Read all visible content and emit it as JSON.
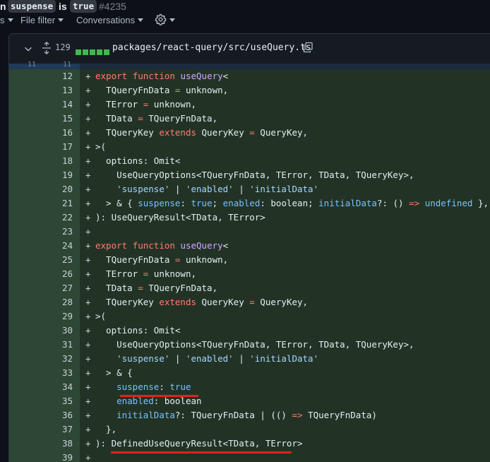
{
  "title": {
    "prefix": "n",
    "code1": "suspense",
    "word": "is",
    "code2": "true",
    "number": "#4235"
  },
  "toolbar": {
    "partial": "s",
    "file_filter": "File filter",
    "conversations": "Conversations",
    "settings_icon": "gear-icon"
  },
  "file": {
    "change_count": "129",
    "path": "packages/react-query/src/useQuery.ts",
    "copy_icon": "copy-icon"
  },
  "hunk": {
    "left": "11",
    "right": "11"
  },
  "lines": [
    {
      "n": "12",
      "tokens": [
        {
          "t": "export",
          "c": "kw"
        },
        {
          "t": " "
        },
        {
          "t": "function",
          "c": "kw"
        },
        {
          "t": " "
        },
        {
          "t": "useQuery",
          "c": "fn"
        },
        {
          "t": "<"
        }
      ]
    },
    {
      "n": "13",
      "tokens": [
        {
          "t": "  TQueryFnData "
        },
        {
          "t": "=",
          "c": "kw"
        },
        {
          "t": " unknown,"
        }
      ]
    },
    {
      "n": "14",
      "tokens": [
        {
          "t": "  TError "
        },
        {
          "t": "=",
          "c": "kw"
        },
        {
          "t": " unknown,"
        }
      ]
    },
    {
      "n": "15",
      "tokens": [
        {
          "t": "  TData "
        },
        {
          "t": "=",
          "c": "kw"
        },
        {
          "t": " TQueryFnData,"
        }
      ]
    },
    {
      "n": "16",
      "tokens": [
        {
          "t": "  TQueryKey "
        },
        {
          "t": "extends",
          "c": "kw"
        },
        {
          "t": " QueryKey "
        },
        {
          "t": "=",
          "c": "kw"
        },
        {
          "t": " QueryKey,"
        }
      ]
    },
    {
      "n": "17",
      "tokens": [
        {
          "t": ">("
        }
      ]
    },
    {
      "n": "18",
      "tokens": [
        {
          "t": "  options: Omit<"
        }
      ]
    },
    {
      "n": "19",
      "tokens": [
        {
          "t": "    UseQueryOptions<TQueryFnData, TError, TData, TQueryKey>,"
        }
      ]
    },
    {
      "n": "20",
      "tokens": [
        {
          "t": "    "
        },
        {
          "t": "'suspense'",
          "c": "str"
        },
        {
          "t": " | "
        },
        {
          "t": "'enabled'",
          "c": "str"
        },
        {
          "t": " | "
        },
        {
          "t": "'initialData'",
          "c": "str"
        }
      ]
    },
    {
      "n": "21",
      "tokens": [
        {
          "t": "  > & { "
        },
        {
          "t": "suspense",
          "c": "con"
        },
        {
          "t": ": "
        },
        {
          "t": "true",
          "c": "con"
        },
        {
          "t": "; "
        },
        {
          "t": "enabled",
          "c": "con"
        },
        {
          "t": ": boolean; "
        },
        {
          "t": "initialData",
          "c": "con"
        },
        {
          "t": "?: () "
        },
        {
          "t": "=>",
          "c": "kw"
        },
        {
          "t": " "
        },
        {
          "t": "undefined",
          "c": "con"
        },
        {
          "t": " },"
        }
      ]
    },
    {
      "n": "22",
      "tokens": [
        {
          "t": "): UseQueryResult<TData, TError>"
        }
      ]
    },
    {
      "n": "23",
      "tokens": []
    },
    {
      "n": "24",
      "tokens": [
        {
          "t": "export",
          "c": "kw"
        },
        {
          "t": " "
        },
        {
          "t": "function",
          "c": "kw"
        },
        {
          "t": " "
        },
        {
          "t": "useQuery",
          "c": "fn"
        },
        {
          "t": "<"
        }
      ]
    },
    {
      "n": "25",
      "tokens": [
        {
          "t": "  TQueryFnData "
        },
        {
          "t": "=",
          "c": "kw"
        },
        {
          "t": " unknown,"
        }
      ]
    },
    {
      "n": "26",
      "tokens": [
        {
          "t": "  TError "
        },
        {
          "t": "=",
          "c": "kw"
        },
        {
          "t": " unknown,"
        }
      ]
    },
    {
      "n": "27",
      "tokens": [
        {
          "t": "  TData "
        },
        {
          "t": "=",
          "c": "kw"
        },
        {
          "t": " TQueryFnData,"
        }
      ]
    },
    {
      "n": "28",
      "tokens": [
        {
          "t": "  TQueryKey "
        },
        {
          "t": "extends",
          "c": "kw"
        },
        {
          "t": " QueryKey "
        },
        {
          "t": "=",
          "c": "kw"
        },
        {
          "t": " QueryKey,"
        }
      ]
    },
    {
      "n": "29",
      "tokens": [
        {
          "t": ">("
        }
      ]
    },
    {
      "n": "30",
      "tokens": [
        {
          "t": "  options: Omit<"
        }
      ]
    },
    {
      "n": "31",
      "tokens": [
        {
          "t": "    UseQueryOptions<TQueryFnData, TError, TData, TQueryKey>,"
        }
      ]
    },
    {
      "n": "32",
      "tokens": [
        {
          "t": "    "
        },
        {
          "t": "'suspense'",
          "c": "str"
        },
        {
          "t": " | "
        },
        {
          "t": "'enabled'",
          "c": "str"
        },
        {
          "t": " | "
        },
        {
          "t": "'initialData'",
          "c": "str"
        }
      ]
    },
    {
      "n": "33",
      "tokens": [
        {
          "t": "  > & {"
        }
      ]
    },
    {
      "n": "34",
      "tokens": [
        {
          "t": "    "
        },
        {
          "t": "suspense",
          "c": "con"
        },
        {
          "t": ": "
        },
        {
          "t": "true",
          "c": "con"
        }
      ]
    },
    {
      "n": "35",
      "tokens": [
        {
          "t": "    "
        },
        {
          "t": "enabled",
          "c": "con"
        },
        {
          "t": ": boolean"
        }
      ]
    },
    {
      "n": "36",
      "tokens": [
        {
          "t": "    "
        },
        {
          "t": "initialData",
          "c": "con"
        },
        {
          "t": "?: TQueryFnData | (() "
        },
        {
          "t": "=>",
          "c": "kw"
        },
        {
          "t": " TQueryFnData)"
        }
      ]
    },
    {
      "n": "37",
      "tokens": [
        {
          "t": "  },"
        }
      ]
    },
    {
      "n": "38",
      "tokens": [
        {
          "t": "): DefinedUseQueryResult<TData, TError>"
        }
      ]
    },
    {
      "n": "39",
      "tokens": []
    }
  ],
  "colors": {
    "added_line_bg": "#223325",
    "added_gutter_bg": "#2d4734",
    "annotation_underline": "#e0231d"
  }
}
